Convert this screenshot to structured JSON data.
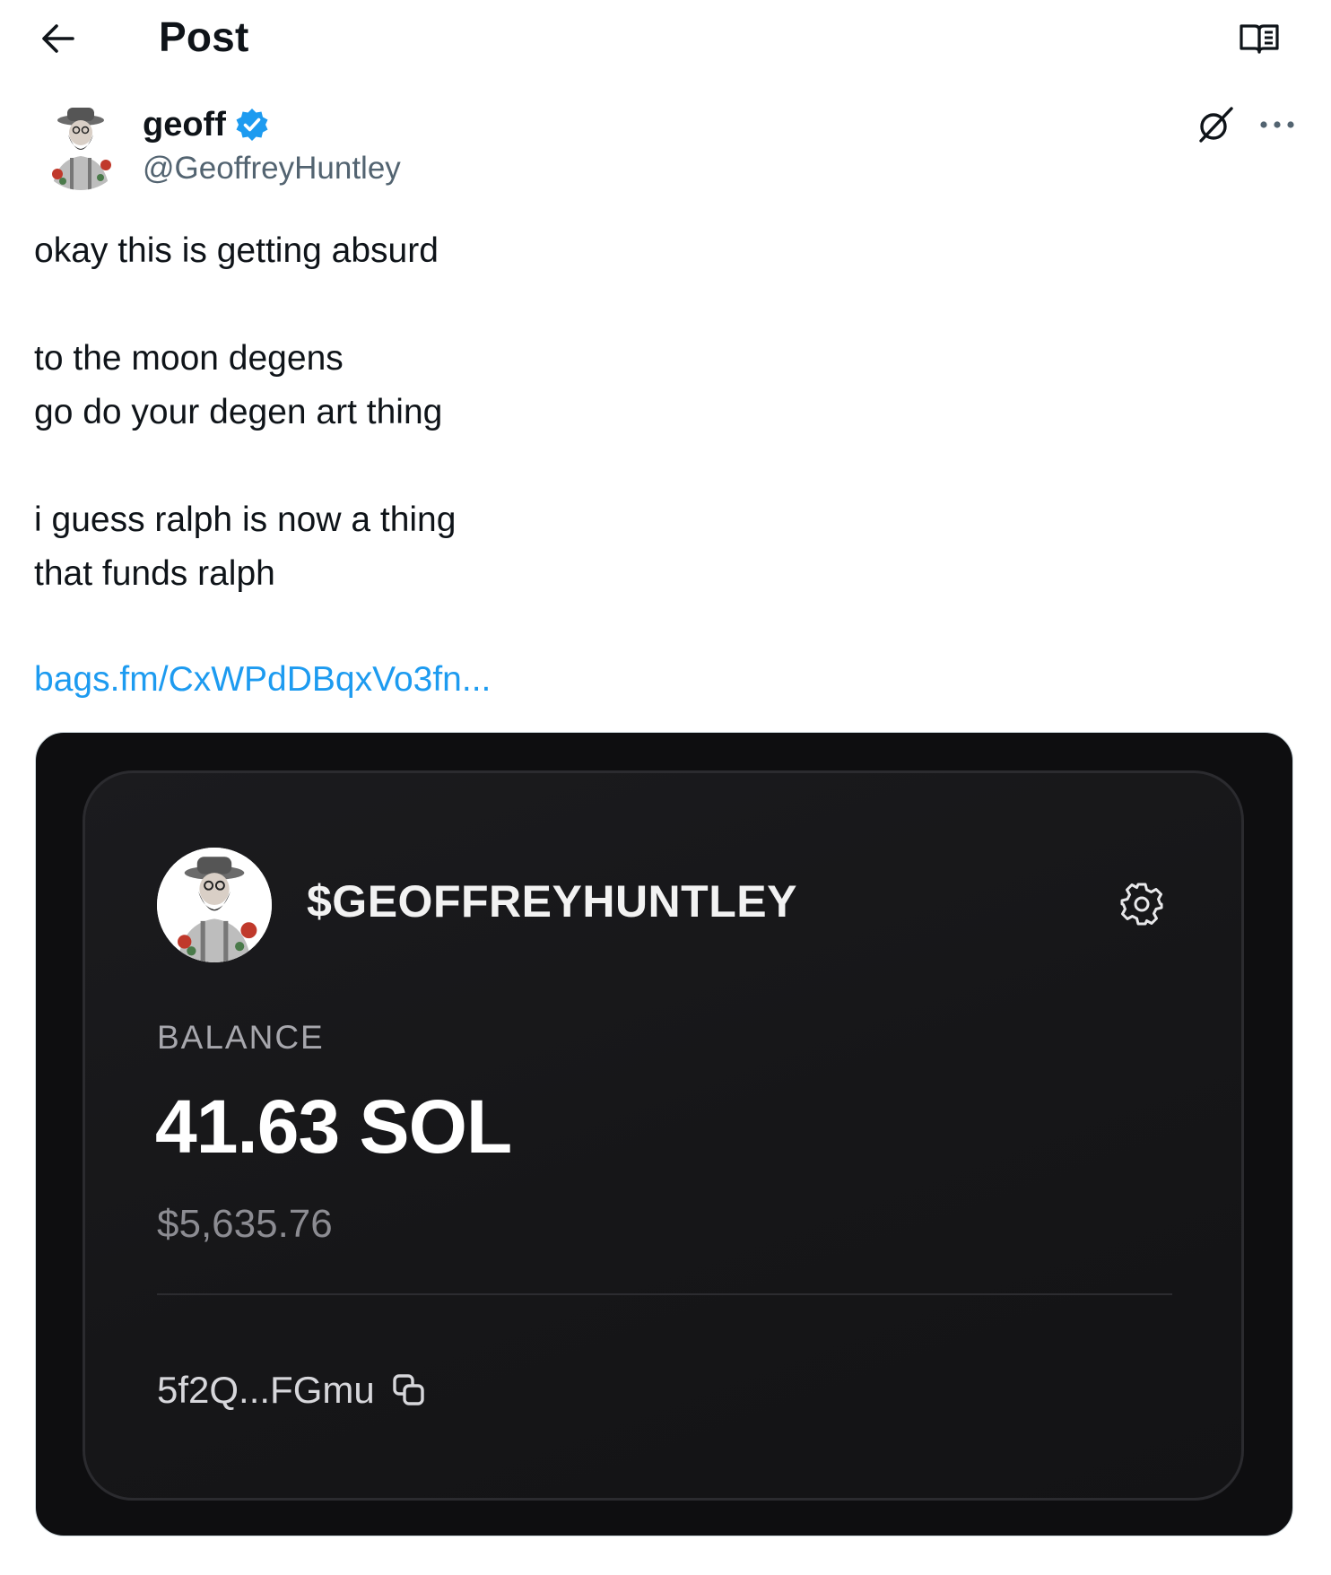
{
  "header": {
    "title": "Post",
    "back_icon": "arrow-left-icon",
    "reader_icon": "reader-mode-icon"
  },
  "author": {
    "name": "geoff",
    "handle": "@GeoffreyHuntley",
    "verified": true,
    "verified_color": "#1d9bf0"
  },
  "post": {
    "lines": [
      "okay this is getting absurd",
      "",
      "to the moon degens",
      "go do your degen art thing",
      "",
      "i guess ralph is now a thing",
      "that funds ralph"
    ],
    "link_text": "bags.fm/CxWPdDBqxVo3fn...",
    "link_color": "#1d9bf0"
  },
  "media": {
    "token_name": "$GEOFFREYHUNTLEY",
    "balance_label": "BALANCE",
    "balance_value": "41.63 SOL",
    "balance_usd": "$5,635.76",
    "address": "5f2Q...FGmu",
    "settings_icon": "gear-icon",
    "copy_icon": "copy-icon"
  },
  "colors": {
    "text_primary": "#0f1419",
    "text_secondary": "#536471",
    "card_bg": "#0e0e10"
  }
}
